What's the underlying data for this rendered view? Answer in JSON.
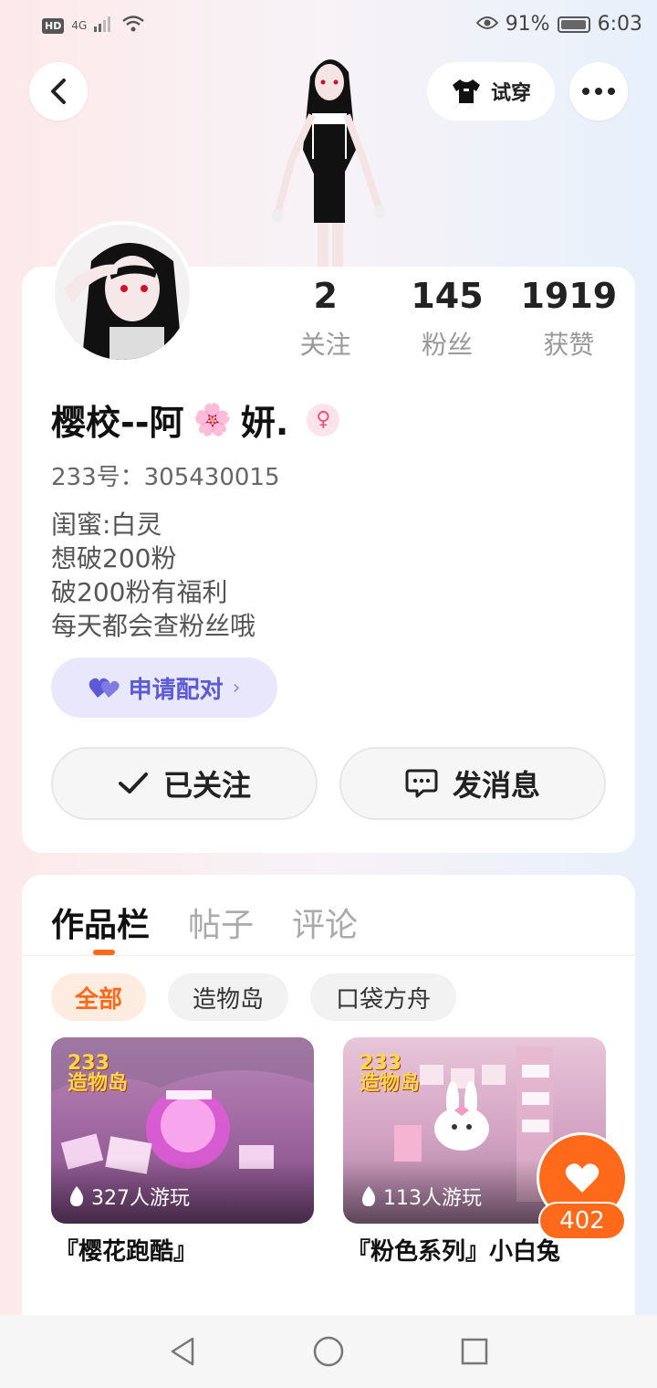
{
  "status": {
    "hd": "HD",
    "signal": "4G",
    "battery": "91%",
    "time": "6:03"
  },
  "header": {
    "tryon_label": "试穿"
  },
  "profile": {
    "name_part1": "樱校--阿",
    "name_part2": "妍.",
    "blossom": "🌸",
    "gender_symbol": "♀",
    "uid": "233号：305430015",
    "bio": [
      "闺蜜:白灵",
      "想破200粉",
      "破200粉有福利",
      "每天都会查粉丝哦"
    ],
    "stats": [
      {
        "value": "2",
        "label": "关注"
      },
      {
        "value": "145",
        "label": "粉丝"
      },
      {
        "value": "1919",
        "label": "获赞"
      }
    ],
    "pair_label": "申请配对",
    "followed_label": "已关注",
    "message_label": "发消息"
  },
  "works": {
    "tabs": [
      "作品栏",
      "帖子",
      "评论"
    ],
    "filters": [
      "全部",
      "造物岛",
      "口袋方舟"
    ],
    "badge": "233\n造物岛",
    "items": [
      {
        "plays": "327人游玩",
        "title": "『樱花跑酷』"
      },
      {
        "plays": "113人游玩",
        "title": "『粉色系列』小白兔"
      }
    ],
    "like_count": "402"
  },
  "colors": {
    "accent": "#ff6a1a",
    "pair": "#5b5bd6",
    "pair_bg": "#e9e7fb"
  }
}
